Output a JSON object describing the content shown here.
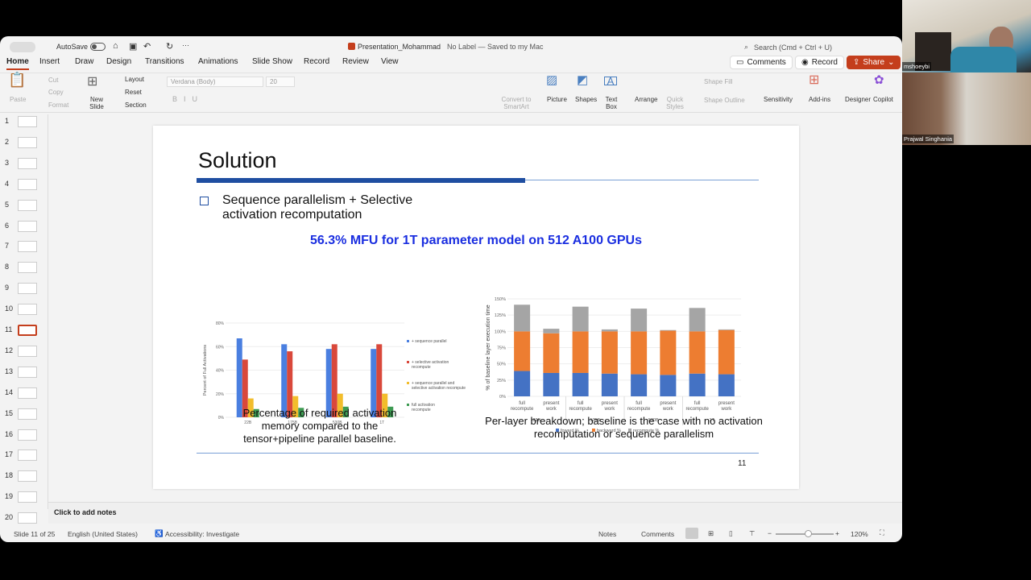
{
  "titlebar": {
    "autosave": "AutoSave",
    "doc_title": "Presentation_Mohammad",
    "label": "No Label — Saved to my Mac",
    "search": "Search (Cmd + Ctrl + U)"
  },
  "tabs": [
    "Home",
    "Insert",
    "Draw",
    "Design",
    "Transitions",
    "Animations",
    "Slide Show",
    "Record",
    "Review",
    "View"
  ],
  "actions": {
    "comments": "Comments",
    "record": "Record",
    "share": "Share"
  },
  "ribbon": {
    "paste": "Paste",
    "cut": "Cut",
    "copy": "Copy",
    "format": "Format",
    "new_slide": "New Slide",
    "layout": "Layout",
    "reset": "Reset",
    "section": "Section",
    "font": "Verdana (Body)",
    "size": "20",
    "convert": "Convert to SmartArt",
    "picture": "Picture",
    "shapes": "Shapes",
    "text_box": "Text Box",
    "arrange": "Arrange",
    "quick_styles": "Quick Styles",
    "shape_fill": "Shape Fill",
    "shape_outline": "Shape Outline",
    "sensitivity": "Sensitivity",
    "addins": "Add-ins",
    "designer": "Designer",
    "copilot": "Copilot"
  },
  "thumbnails": [
    "1",
    "2",
    "3",
    "4",
    "5",
    "6",
    "7",
    "8",
    "9",
    "10",
    "11",
    "12",
    "13",
    "14",
    "15",
    "16",
    "17",
    "18",
    "19",
    "20"
  ],
  "selected_slide": "11",
  "slide": {
    "title": "Solution",
    "bullet": "Sequence parallelism + Selective activation recomputation",
    "headline": "56.3% MFU for 1T parameter model on 512 A100 GPUs",
    "caption_left": "Percentage of required activation memory compared to the tensor+pipeline parallel baseline.",
    "caption_right": "Per-layer breakdown; baseline is the case with no activation recomputation or sequence parallelism",
    "page_number": "11"
  },
  "chart_data": [
    {
      "type": "bar",
      "xlabel": "Model Size",
      "ylabel": "Percent of Full Activations",
      "ylim": [
        0,
        80
      ],
      "yticks": [
        "0%",
        "20%",
        "40%",
        "60%",
        "80%"
      ],
      "grid": true,
      "legend": "right",
      "categories": [
        "22B",
        "175B",
        "530B",
        "1T"
      ],
      "series": [
        {
          "name": "+ sequence parallel",
          "color": "#4a7fe0",
          "values": [
            67,
            62,
            58,
            58
          ]
        },
        {
          "name": "+ selective activation recompute",
          "color": "#d9483b",
          "values": [
            49,
            56,
            62,
            62
          ]
        },
        {
          "name": "+ sequence parallel and selective activation recompute",
          "color": "#f2bd2c",
          "values": [
            16,
            18,
            20,
            20
          ]
        },
        {
          "name": "full activation recompute",
          "color": "#3d9a52",
          "values": [
            7,
            8,
            9,
            9
          ]
        }
      ]
    },
    {
      "type": "bar",
      "stacked": true,
      "ylabel": "% of baseline layer execution time",
      "ylim": [
        0,
        150
      ],
      "yticks": [
        "0%",
        "25%",
        "50%",
        "75%",
        "100%",
        "125%",
        "150%"
      ],
      "grid": true,
      "legend": "bottom",
      "categories": [
        "full recompute",
        "present work",
        "full recompute",
        "present work",
        "full recompute",
        "present work",
        "full recompute",
        "present work"
      ],
      "groups": [
        "22B",
        "175B",
        "530B",
        "1T"
      ],
      "series": [
        {
          "name": "foward %",
          "color": "#4472c4",
          "values": [
            39,
            36,
            36,
            35,
            34,
            33,
            35,
            34
          ]
        },
        {
          "name": "backward %",
          "color": "#ed7d31",
          "values": [
            61,
            61,
            64,
            65,
            66,
            68,
            65,
            68
          ]
        },
        {
          "name": "recompute %",
          "color": "#a5a5a5",
          "values": [
            41,
            7,
            38,
            3,
            35,
            1,
            36,
            1
          ]
        }
      ]
    }
  ],
  "notes": {
    "placeholder": "Click to add notes"
  },
  "status": {
    "slide": "Slide 11 of 25",
    "language": "English (United States)",
    "accessibility": "Accessibility: Investigate",
    "notes": "Notes",
    "comments": "Comments",
    "zoom": "120%",
    "zoom_level": 0.55
  },
  "video": [
    {
      "name": "mshoeybi"
    },
    {
      "name": "Prajwal Singhania"
    }
  ]
}
